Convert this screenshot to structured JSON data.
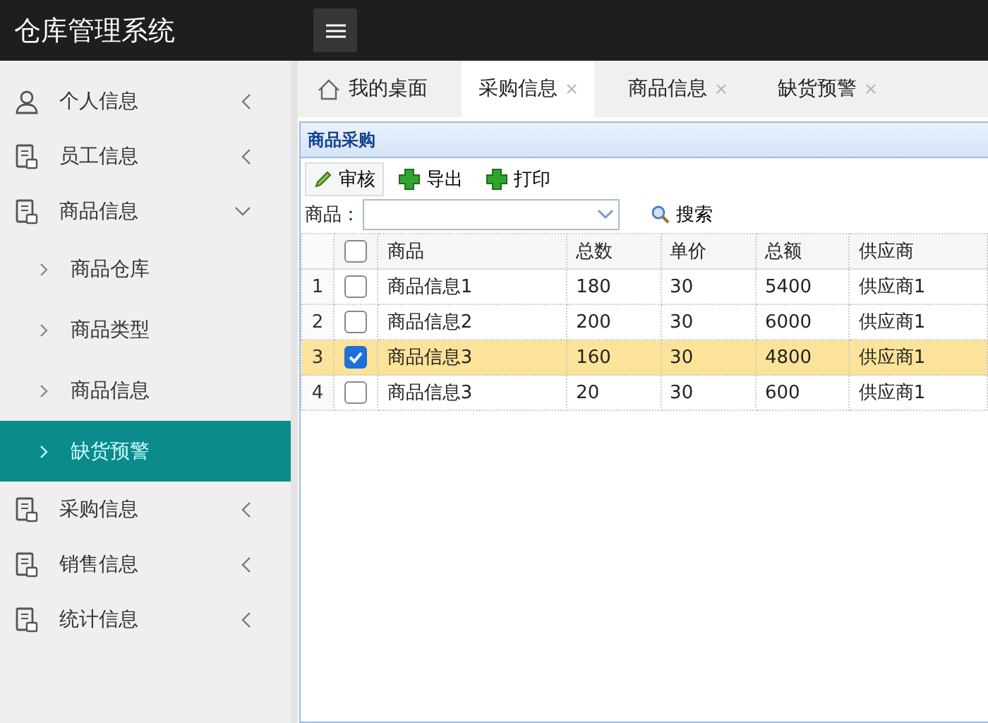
{
  "app": {
    "title": "仓库管理系统"
  },
  "sidebar": {
    "items": [
      {
        "label": "个人信息",
        "kind": "person",
        "expanded": false
      },
      {
        "label": "员工信息",
        "kind": "document",
        "expanded": false
      },
      {
        "label": "商品信息",
        "kind": "document",
        "expanded": true,
        "children": [
          {
            "label": "商品仓库",
            "selected": false
          },
          {
            "label": "商品类型",
            "selected": false
          },
          {
            "label": "商品信息",
            "selected": false
          },
          {
            "label": "缺货预警",
            "selected": true
          }
        ]
      },
      {
        "label": "采购信息",
        "kind": "document",
        "expanded": false
      },
      {
        "label": "销售信息",
        "kind": "document",
        "expanded": false
      },
      {
        "label": "统计信息",
        "kind": "document",
        "expanded": false
      }
    ]
  },
  "tabs": [
    {
      "label": "我的桌面",
      "kind": "home",
      "selected": false
    },
    {
      "label": "采购信息",
      "kind": "closable",
      "selected": true
    },
    {
      "label": "商品信息",
      "kind": "closable",
      "selected": false
    },
    {
      "label": "缺货预警",
      "kind": "closable",
      "selected": false
    }
  ],
  "panel": {
    "title": "商品采购",
    "toolbar": [
      {
        "label": "审核",
        "kind": "edit"
      },
      {
        "label": "导出",
        "kind": "add"
      },
      {
        "label": "打印",
        "kind": "add"
      }
    ],
    "filter": {
      "label": "商品：",
      "search": "搜索"
    },
    "table": {
      "columns": [
        "商品",
        "总数",
        "单价",
        "总额",
        "供应商"
      ],
      "all_checked": false,
      "rows": [
        {
          "number": "1",
          "checked": false,
          "cells": [
            "商品信息1",
            "180",
            "30",
            "5400",
            "供应商1"
          ]
        },
        {
          "number": "2",
          "checked": false,
          "cells": [
            "商品信息2",
            "200",
            "30",
            "6000",
            "供应商1"
          ]
        },
        {
          "number": "3",
          "checked": true,
          "cells": [
            "商品信息3",
            "160",
            "30",
            "4800",
            "供应商1"
          ]
        },
        {
          "number": "4",
          "checked": false,
          "cells": [
            "商品信息3",
            "20",
            "30",
            "600",
            "供应商1"
          ]
        }
      ]
    }
  }
}
